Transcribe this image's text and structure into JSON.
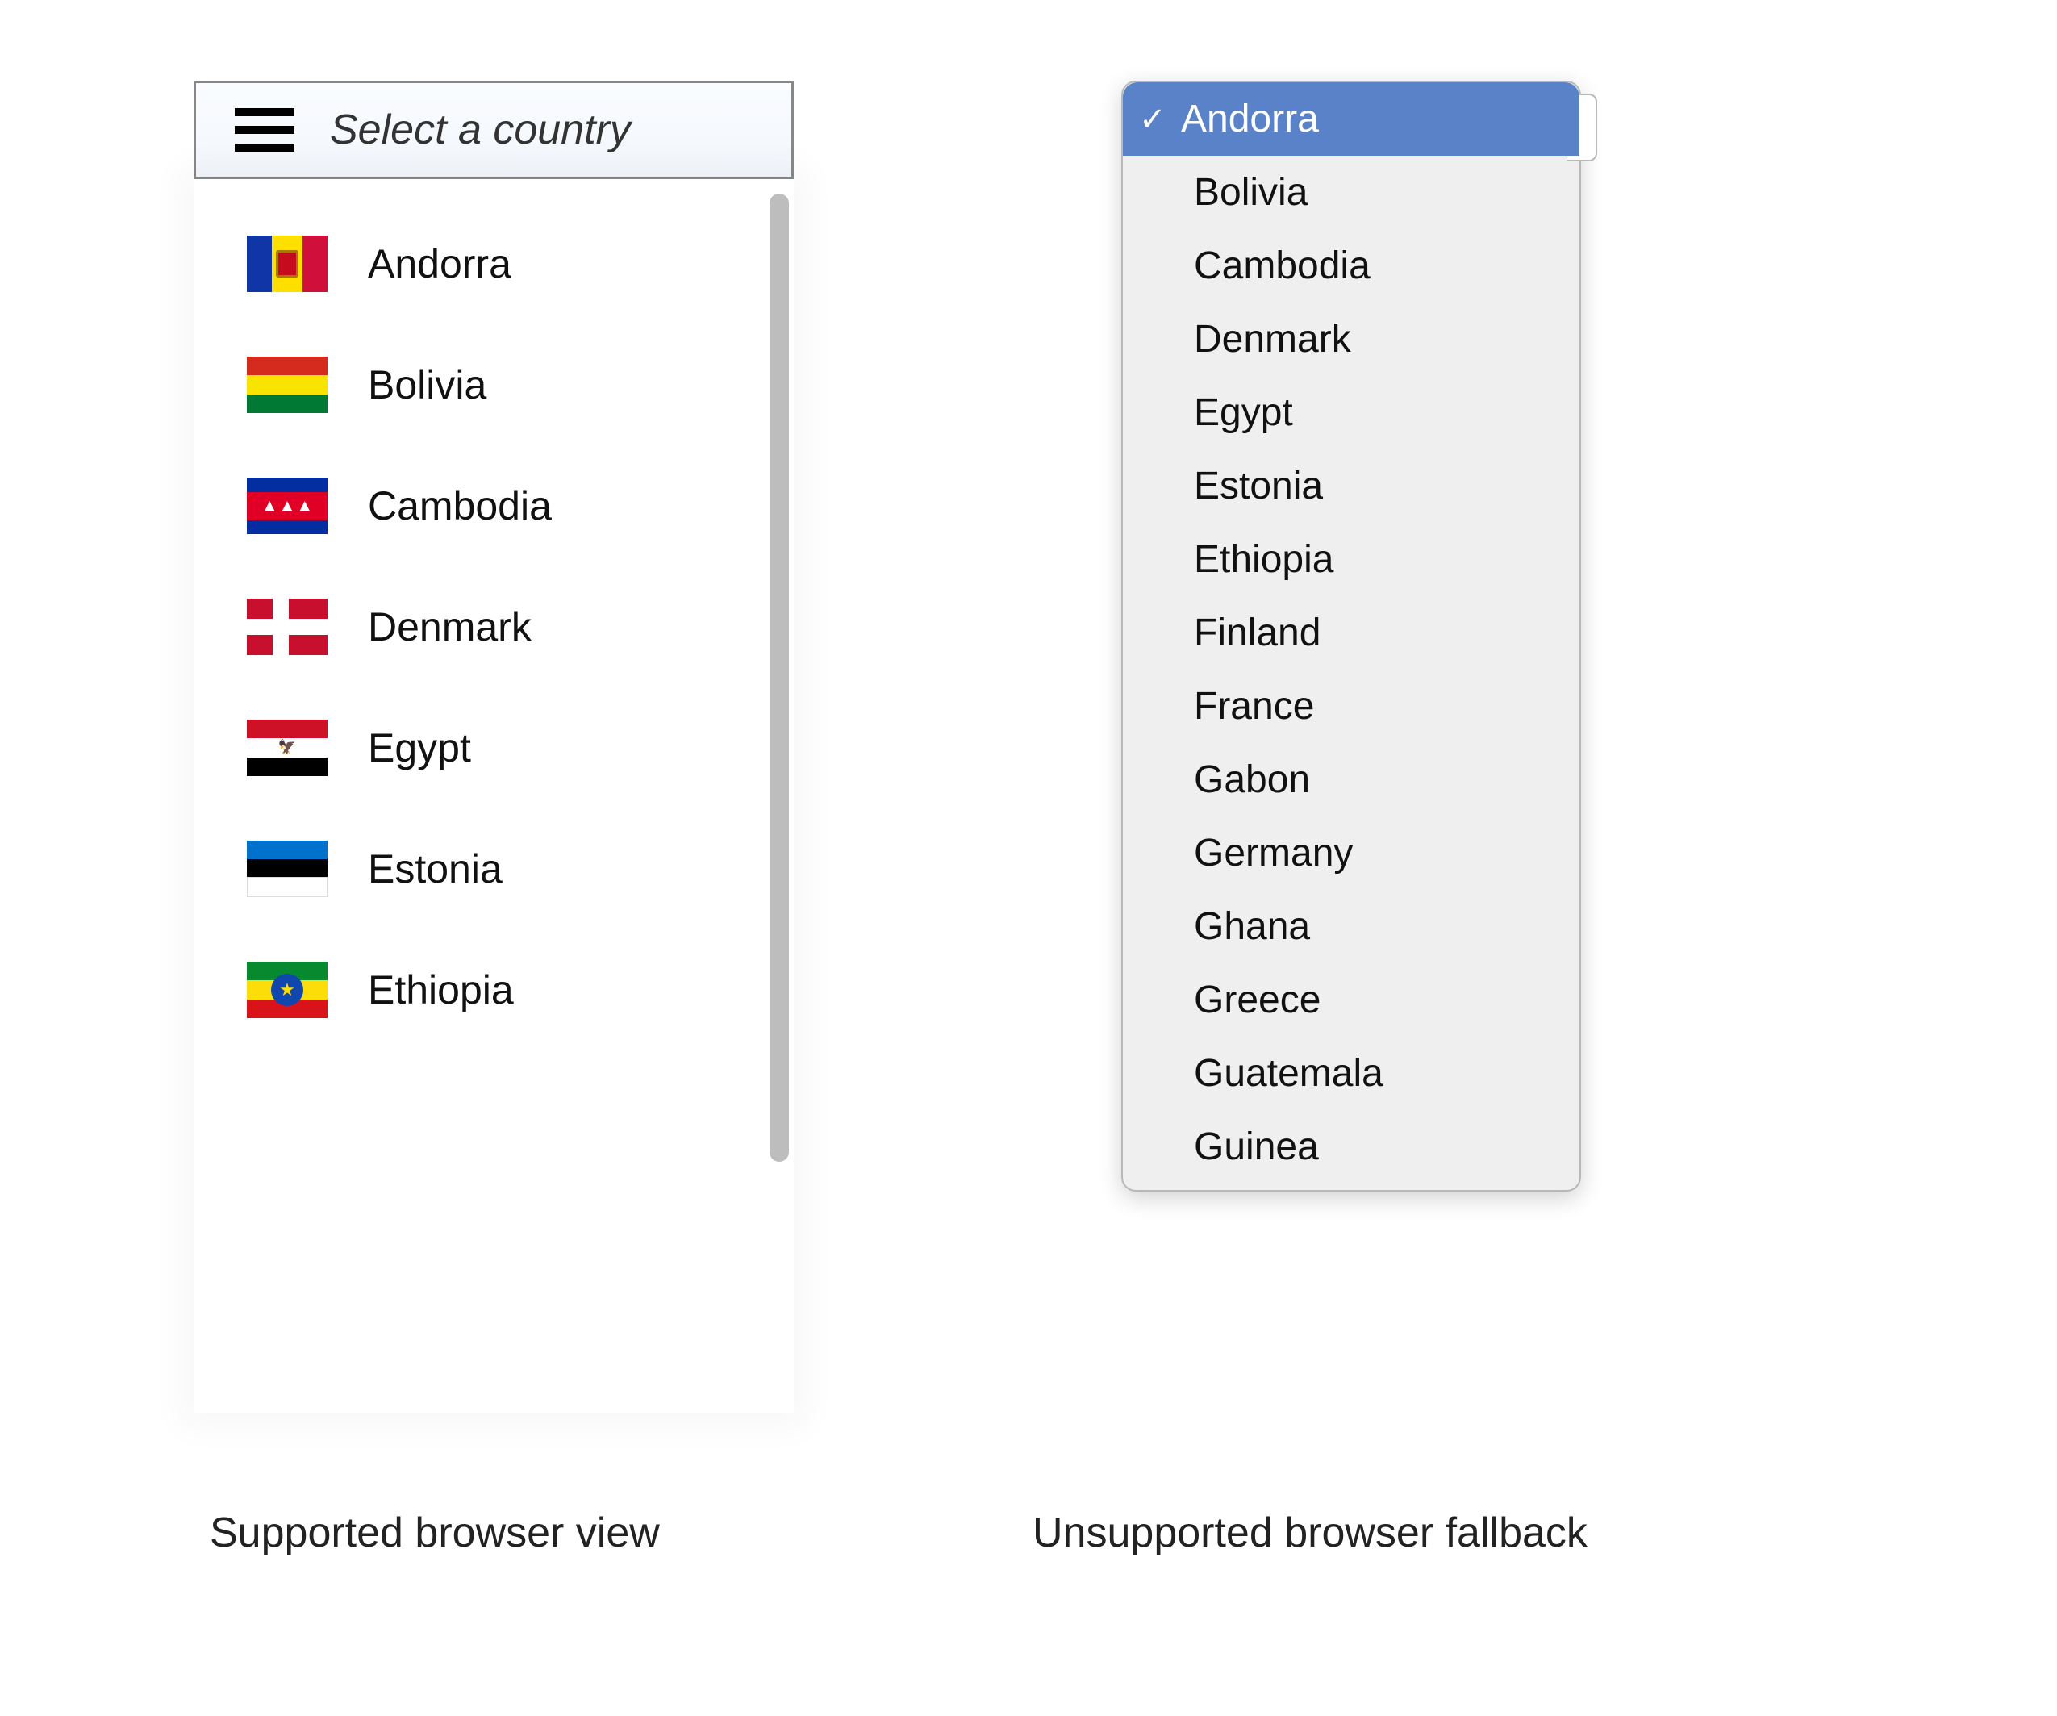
{
  "custom_select": {
    "placeholder": "Select a country",
    "options": [
      {
        "label": "Andorra",
        "flag": "andorra"
      },
      {
        "label": "Bolivia",
        "flag": "bolivia"
      },
      {
        "label": "Cambodia",
        "flag": "cambodia"
      },
      {
        "label": "Denmark",
        "flag": "denmark"
      },
      {
        "label": "Egypt",
        "flag": "egypt"
      },
      {
        "label": "Estonia",
        "flag": "estonia"
      },
      {
        "label": "Ethiopia",
        "flag": "ethiopia"
      }
    ]
  },
  "native_select": {
    "selected_index": 0,
    "options": [
      "Andorra",
      "Bolivia",
      "Cambodia",
      "Denmark",
      "Egypt",
      "Estonia",
      "Ethiopia",
      "Finland",
      "France",
      "Gabon",
      "Germany",
      "Ghana",
      "Greece",
      "Guatemala",
      "Guinea"
    ]
  },
  "captions": {
    "left": "Supported browser view",
    "right": "Unsupported browser fallback"
  },
  "icons": {
    "check": "✓"
  }
}
